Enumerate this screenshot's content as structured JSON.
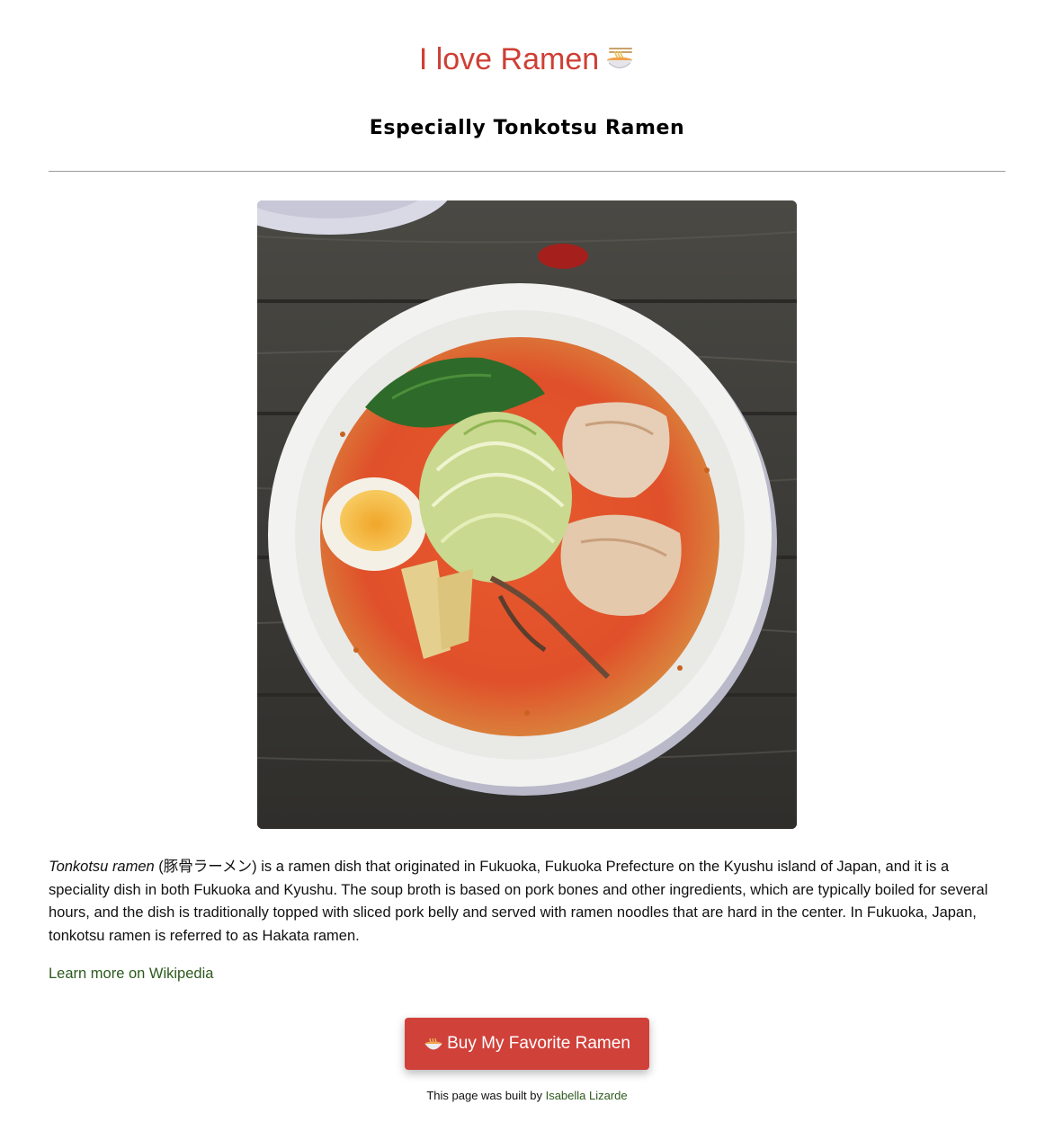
{
  "header": {
    "title": "I love Ramen",
    "title_icon": "ramen-bowl-icon",
    "subtitle": "Especially Tonkotsu Ramen"
  },
  "colors": {
    "title": "#cf3f34",
    "button": "#d0413a",
    "link": "#2d5a1d"
  },
  "image": {
    "subject": "bowl of spicy tonkotsu ramen"
  },
  "description": {
    "term": "Tonkotsu ramen",
    "text": " (豚骨ラーメン) is a ramen dish that originated in Fukuoka, Fukuoka Prefecture on the Kyushu island of Japan, and it is a speciality dish in both Fukuoka and Kyushu. The soup broth is based on pork bones and other ingredients, which are typically boiled for several hours, and the dish is traditionally topped with sliced pork belly and served with ramen noodles that are hard in the center. In Fukuoka, Japan, tonkotsu ramen is referred to as Hakata ramen."
  },
  "links": {
    "wikipedia": "Learn more on Wikipedia"
  },
  "button": {
    "label": "Buy My Favorite Ramen",
    "icon": "ramen-bowl-icon"
  },
  "footer": {
    "prefix": "This page was built by ",
    "author": "Isabella Lizarde"
  }
}
